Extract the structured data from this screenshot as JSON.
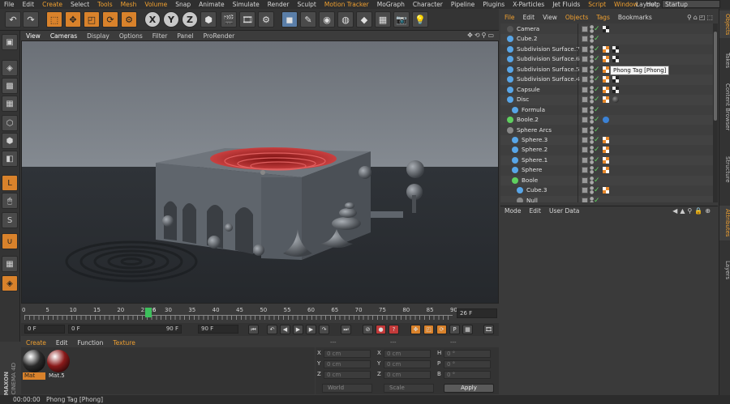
{
  "menu": {
    "items": [
      "File",
      "Edit",
      "Create",
      "Select",
      "Tools",
      "Mesh",
      "Volume",
      "Snap",
      "Animate",
      "Simulate",
      "Render",
      "Sculpt",
      "Motion Tracker",
      "MoGraph",
      "Character",
      "Pipeline",
      "Plugins",
      "X-Particles",
      "Jet Fluids",
      "Script",
      "Window",
      "Help"
    ],
    "highlighted": [
      "Create",
      "Tools",
      "Mesh",
      "Volume",
      "Motion Tracker",
      "Script",
      "Window"
    ],
    "layout_label": "Layout:",
    "layout_value": "Startup"
  },
  "viewport": {
    "menu": [
      "View",
      "Cameras",
      "Display",
      "Options",
      "Filter",
      "Panel",
      "ProRender"
    ]
  },
  "timeline": {
    "ticks": [
      "0",
      "5",
      "10",
      "15",
      "20",
      "25",
      "26",
      "30",
      "35",
      "40",
      "45",
      "50",
      "55",
      "60",
      "65",
      "70",
      "75",
      "80",
      "85",
      "90"
    ],
    "current_frame": 26,
    "max_frame": 90,
    "frame_field": "26 F"
  },
  "transport": {
    "start": "0 F",
    "range_start": "0 F",
    "range_end": "90 F",
    "end": "90 F"
  },
  "materials": {
    "menu": [
      "Create",
      "Edit",
      "Function",
      "Texture"
    ],
    "highlighted": [
      "Create",
      "Texture"
    ],
    "items": [
      {
        "name": "Mat",
        "selected": true,
        "color": "#2a2a2a"
      },
      {
        "name": "Mat.5",
        "selected": false,
        "color": "#8a1a1a"
      }
    ],
    "brand_top": "MAXON",
    "brand_bottom": "CINEMA 4D"
  },
  "coordinates": {
    "header_left": "---",
    "header_mid": "---",
    "header_right": "---",
    "rows": [
      {
        "a": "X",
        "av": "0 cm",
        "b": "X",
        "bv": "0 cm",
        "c": "H",
        "cv": "0 °"
      },
      {
        "a": "Y",
        "av": "0 cm",
        "b": "Y",
        "bv": "0 cm",
        "c": "P",
        "cv": "0 °"
      },
      {
        "a": "Z",
        "av": "0 cm",
        "b": "Z",
        "bv": "0 cm",
        "c": "B",
        "cv": "0 °"
      }
    ],
    "mode": "World",
    "scale": "Scale",
    "apply": "Apply"
  },
  "status": {
    "time": "00:00:00",
    "message": "Phong Tag [Phong]"
  },
  "object_manager": {
    "menu": [
      "File",
      "Edit",
      "View",
      "Objects",
      "Tags",
      "Bookmarks"
    ],
    "highlighted": [
      "File",
      "Objects",
      "Tags"
    ],
    "objects": [
      {
        "name": "Camera",
        "indent": 0,
        "icon": "camera-icon",
        "tags": [
          "chk2"
        ]
      },
      {
        "name": "Cube.2",
        "indent": 0,
        "icon": "cube-icon",
        "tags": []
      },
      {
        "name": "Subdivision Surface.7",
        "indent": 0,
        "icon": "subdivision-icon",
        "tags": [
          "phong",
          "chk2"
        ]
      },
      {
        "name": "Subdivision Surface.6",
        "indent": 0,
        "icon": "subdivision-icon",
        "tags": [
          "phong",
          "chk2"
        ]
      },
      {
        "name": "Subdivision Surface.5",
        "indent": 0,
        "icon": "subdivision-icon",
        "tags": [
          "phong"
        ]
      },
      {
        "name": "Subdivision Surface.4",
        "indent": 0,
        "icon": "subdivision-icon",
        "tags": [
          "phong",
          "chk2"
        ]
      },
      {
        "name": "Capsule",
        "indent": 0,
        "icon": "capsule-icon",
        "tags": [
          "phong",
          "chk2"
        ]
      },
      {
        "name": "Disc",
        "indent": 0,
        "icon": "disc-icon",
        "tags": [
          "phong",
          "ballm"
        ]
      },
      {
        "name": "Formula",
        "indent": 1,
        "icon": "formula-icon",
        "tags": []
      },
      {
        "name": "Boole.2",
        "indent": 0,
        "icon": "boole-icon",
        "tags": [
          "blue"
        ]
      },
      {
        "name": "Sphere Arcs",
        "indent": 0,
        "icon": "null-icon",
        "tags": []
      },
      {
        "name": "Sphere.3",
        "indent": 1,
        "icon": "sphere-icon",
        "tags": [
          "phong"
        ]
      },
      {
        "name": "Sphere.2",
        "indent": 1,
        "icon": "sphere-icon",
        "tags": [
          "phong"
        ]
      },
      {
        "name": "Sphere.1",
        "indent": 1,
        "icon": "sphere-icon",
        "tags": [
          "phong"
        ]
      },
      {
        "name": "Sphere",
        "indent": 1,
        "icon": "sphere-icon",
        "tags": [
          "phong"
        ]
      },
      {
        "name": "Boole",
        "indent": 1,
        "icon": "boole-icon",
        "tags": []
      },
      {
        "name": "Cube.3",
        "indent": 2,
        "icon": "cube-icon",
        "tags": [
          "phong"
        ]
      },
      {
        "name": "Null",
        "indent": 2,
        "icon": "null-icon",
        "tags": []
      }
    ],
    "tooltip": "Phong Tag [Phong]"
  },
  "attributes": {
    "menu": [
      "Mode",
      "Edit",
      "User Data"
    ]
  },
  "right_tabs": {
    "top": [
      "Objects",
      "Takes",
      "Content Browser",
      "Structure"
    ],
    "bottom": [
      "Attributes",
      "Layers"
    ]
  },
  "colors": {
    "accent": "#d9822b",
    "highlight_text": "#f0a030",
    "frame_indicator": "#3dbf5c"
  }
}
